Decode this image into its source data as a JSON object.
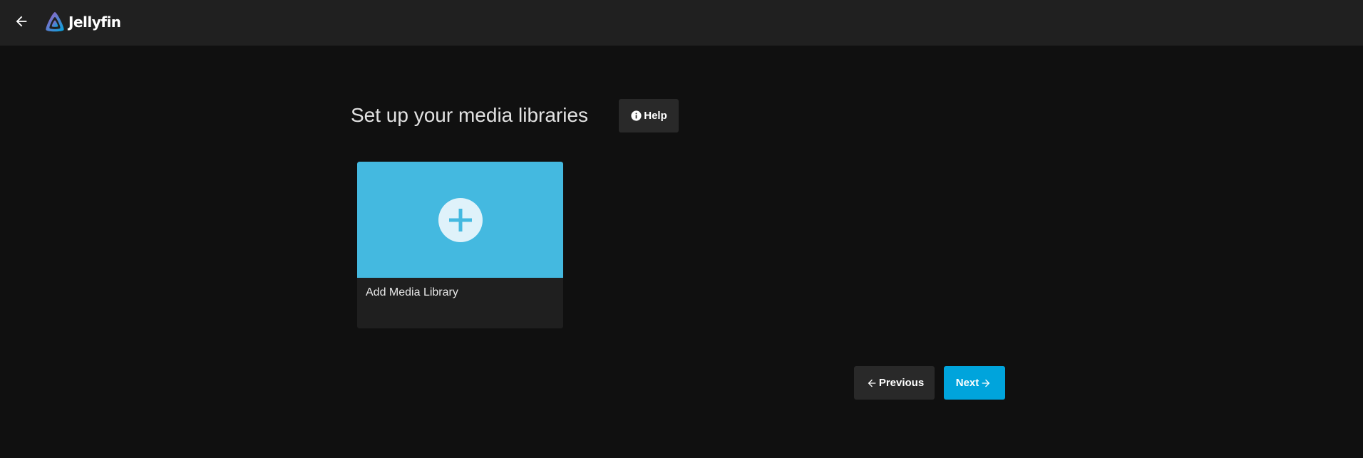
{
  "header": {
    "back_icon": "arrow-left-icon",
    "logo_icon": "jellyfin-logo-icon",
    "app_name": "Jellyfin"
  },
  "main": {
    "title": "Set up your media libraries",
    "help_icon": "info-circle-icon",
    "help_label": "Help",
    "cards": [
      {
        "label": "Add Media Library",
        "icon": "plus-icon",
        "color": "#44b9e0"
      }
    ]
  },
  "footer": {
    "previous_label": "Previous",
    "previous_icon": "arrow-left-icon",
    "next_label": "Next",
    "next_icon": "arrow-right-icon"
  },
  "colors": {
    "background": "#101010",
    "header": "#202020",
    "accent": "#00a4dc",
    "card_image": "#44b9e0"
  }
}
